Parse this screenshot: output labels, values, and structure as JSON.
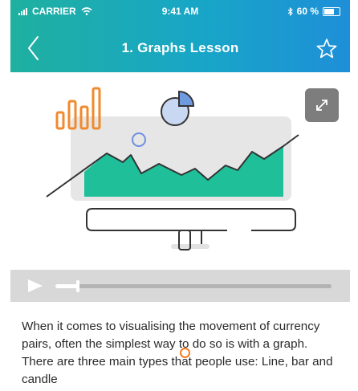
{
  "status_bar": {
    "carrier": "CARRIER",
    "time": "9:41 AM",
    "battery": "60 %"
  },
  "nav": {
    "title": "1. Graphs Lesson",
    "back_icon": "chevron-left-icon",
    "favorite_icon": "star-outline-icon"
  },
  "colors": {
    "header_start": "#1fb0a0",
    "header_end": "#1e8fd8",
    "accent_orange": "#f57c20",
    "accent_green": "#1fbf9a"
  },
  "media": {
    "expand_icon": "expand-arrows-icon",
    "play_icon": "play-icon",
    "progress": 0.08
  },
  "lesson": {
    "body": "When it comes to visualising the movement of currency pairs, often the simplest way to do so is with a graph. There are three main types that people use: Line, bar and candle"
  }
}
